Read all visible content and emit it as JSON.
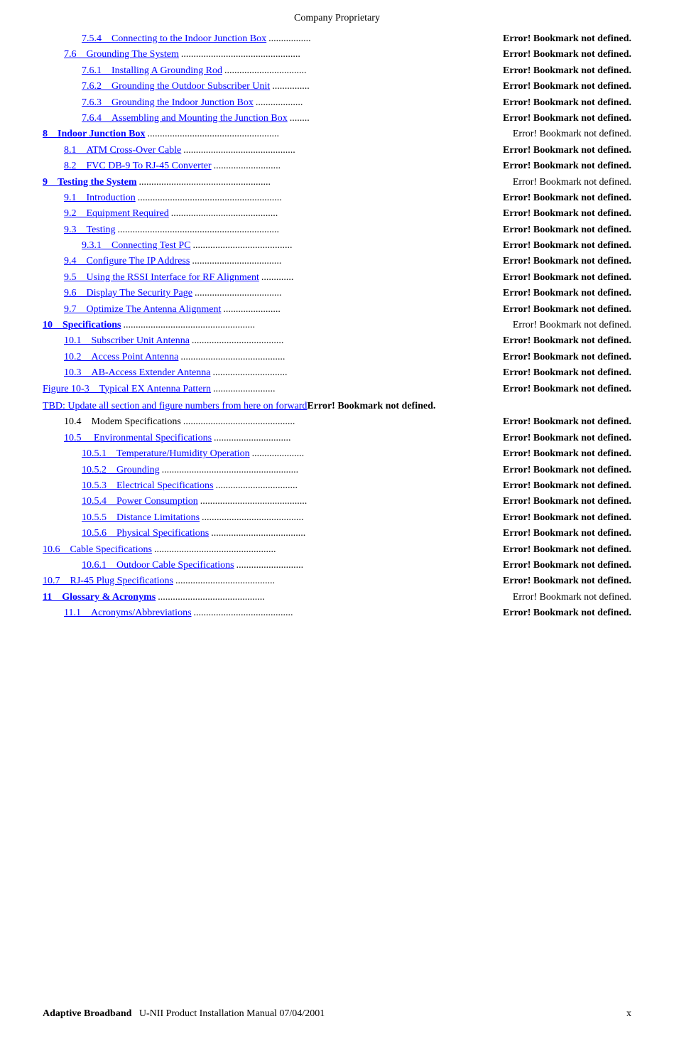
{
  "header": {
    "title": "Company Proprietary"
  },
  "footer": {
    "brand": "Adaptive Broadband",
    "manual": "U-NII Product Installation Manual  07/04/2001",
    "page": "x"
  },
  "toc": {
    "entries": [
      {
        "num": "7.5.4",
        "indent": 2,
        "link": true,
        "title": "Connecting to the Indoor Junction Box",
        "dots": ".................",
        "error": "Error! Bookmark not defined.",
        "error_bold": true
      },
      {
        "num": "7.6",
        "indent": 1,
        "link": true,
        "title": "Grounding The System",
        "dots": "................................................",
        "error": "Error! Bookmark not defined.",
        "error_bold": true
      },
      {
        "num": "7.6.1",
        "indent": 2,
        "link": true,
        "title": "Installing A Grounding Rod",
        "dots": ".................................",
        "error": "Error! Bookmark not defined.",
        "error_bold": true
      },
      {
        "num": "7.6.2",
        "indent": 2,
        "link": true,
        "title": "Grounding the Outdoor Subscriber Unit",
        "dots": "...............",
        "error": "Error! Bookmark not defined.",
        "error_bold": true
      },
      {
        "num": "7.6.3",
        "indent": 2,
        "link": true,
        "title": "Grounding the Indoor Junction Box",
        "dots": "...................",
        "error": "Error! Bookmark not defined.",
        "error_bold": true
      },
      {
        "num": "7.6.4",
        "indent": 2,
        "link": true,
        "title": "Assembling and Mounting the Junction Box",
        "dots": "........",
        "error": "Error! Bookmark not defined.",
        "error_bold": true
      },
      {
        "num": "8",
        "indent": 0,
        "link": true,
        "title": "Indoor Junction Box",
        "bold_title": true,
        "dots": ".....................................................",
        "error": "Error! Bookmark not defined.",
        "error_bold": false
      },
      {
        "num": "8.1",
        "indent": 1,
        "link": true,
        "title": "ATM Cross-Over Cable",
        "dots": ".............................................",
        "error": "Error! Bookmark not defined.",
        "error_bold": true
      },
      {
        "num": "8.2",
        "indent": 1,
        "link": true,
        "title": "FVC DB-9 To RJ-45 Converter",
        "dots": "...........................",
        "error": "Error! Bookmark not defined.",
        "error_bold": true
      },
      {
        "num": "9",
        "indent": 0,
        "link": true,
        "title": "Testing the System",
        "bold_title": true,
        "dots": ".....................................................",
        "error": "Error! Bookmark not defined.",
        "error_bold": false
      },
      {
        "num": "9.1",
        "indent": 1,
        "link": true,
        "title": "Introduction",
        "dots": "..........................................................",
        "error": "Error! Bookmark not defined.",
        "error_bold": true
      },
      {
        "num": "9.2",
        "indent": 1,
        "link": true,
        "title": "Equipment Required",
        "dots": "...........................................",
        "error": "Error! Bookmark not defined.",
        "error_bold": true
      },
      {
        "num": "9.3",
        "indent": 1,
        "link": true,
        "title": "Testing",
        "dots": ".................................................................",
        "error": "Error! Bookmark not defined.",
        "error_bold": true
      },
      {
        "num": "9.3.1",
        "indent": 2,
        "link": true,
        "title": "Connecting Test PC",
        "dots": "........................................",
        "error": "Error! Bookmark not defined.",
        "error_bold": true
      },
      {
        "num": "9.4",
        "indent": 1,
        "link": true,
        "title": "Configure The IP Address",
        "dots": "....................................",
        "error": "Error! Bookmark not defined.",
        "error_bold": true
      },
      {
        "num": "9.5",
        "indent": 1,
        "link": true,
        "title": "Using the RSSI Interface for RF Alignment",
        "dots": ".............",
        "error": "Error! Bookmark not defined.",
        "error_bold": true
      },
      {
        "num": "9.6",
        "indent": 1,
        "link": true,
        "title": "Display The Security Page",
        "dots": "...................................",
        "error": "Error! Bookmark not defined.",
        "error_bold": true
      },
      {
        "num": "9.7",
        "indent": 1,
        "link": true,
        "title": "Optimize The Antenna Alignment",
        "dots": ".......................",
        "error": "Error! Bookmark not defined.",
        "error_bold": true
      },
      {
        "num": "10",
        "indent": 0,
        "link": true,
        "title": "Specifications",
        "bold_title": true,
        "dots": ".....................................................",
        "error": "Error! Bookmark not defined.",
        "error_bold": false
      },
      {
        "num": "10.1",
        "indent": 1,
        "link": true,
        "title": "Subscriber Unit Antenna",
        "dots": ".....................................",
        "error": "Error! Bookmark not defined.",
        "error_bold": true
      },
      {
        "num": "10.2",
        "indent": 1,
        "link": true,
        "title": "Access Point Antenna",
        "dots": "..........................................",
        "error": "Error! Bookmark not defined.",
        "error_bold": true
      },
      {
        "num": "10.3",
        "indent": 1,
        "link": true,
        "title": "AB-Access Extender Antenna",
        "dots": "..............................",
        "error": "Error! Bookmark not defined.",
        "error_bold": true
      },
      {
        "num": "Figure 10-3",
        "indent": 0,
        "link": true,
        "title": "Typical EX Antenna Pattern",
        "dots": ".........................",
        "error": "Error! Bookmark not defined.",
        "error_bold": true
      },
      {
        "num": "",
        "indent": 0,
        "link": true,
        "title": "TBD: Update all section and figure numbers from here on forward",
        "dots": "",
        "error": "Error! Bookmark not defined.",
        "error_bold": true,
        "special": true
      },
      {
        "num": "10.4",
        "indent": 1,
        "link": false,
        "title": "Modem Specifications",
        "dots": ".............................................",
        "error": "Error! Bookmark not defined.",
        "error_bold": true
      },
      {
        "num": "10.5",
        "indent": 1,
        "link": true,
        "title": " Environmental Specifications",
        "dots": "...............................",
        "error": "Error! Bookmark not defined.",
        "error_bold": true
      },
      {
        "num": "10.5.1",
        "indent": 2,
        "link": true,
        "title": "Temperature/Humidity Operation",
        "dots": ".....................",
        "error": "Error! Bookmark not defined.",
        "error_bold": true
      },
      {
        "num": "10.5.2",
        "indent": 2,
        "link": true,
        "title": "Grounding",
        "dots": ".......................................................",
        "error": "Error! Bookmark not defined.",
        "error_bold": true
      },
      {
        "num": "10.5.3",
        "indent": 2,
        "link": true,
        "title": "Electrical Specifications",
        "dots": ".................................",
        "error": "Error! Bookmark not defined.",
        "error_bold": true
      },
      {
        "num": "10.5.4",
        "indent": 2,
        "link": true,
        "title": "Power Consumption",
        "dots": "...........................................",
        "error": "Error! Bookmark not defined.",
        "error_bold": true
      },
      {
        "num": "10.5.5",
        "indent": 2,
        "link": true,
        "title": "Distance Limitations",
        "dots": ".........................................",
        "error": "Error! Bookmark not defined.",
        "error_bold": true
      },
      {
        "num": "10.5.6",
        "indent": 2,
        "link": true,
        "title": "Physical Specifications",
        "dots": "......................................",
        "error": "Error! Bookmark not defined.",
        "error_bold": true
      },
      {
        "num": "10.6",
        "indent": 0,
        "link": true,
        "title": "Cable Specifications",
        "dots": ".................................................",
        "error": "Error! Bookmark not defined.",
        "error_bold": true
      },
      {
        "num": "10.6.1",
        "indent": 2,
        "link": true,
        "title": "Outdoor Cable Specifications",
        "dots": "...........................",
        "error": "Error! Bookmark not defined.",
        "error_bold": true
      },
      {
        "num": "10.7",
        "indent": 0,
        "link": true,
        "title": "RJ-45 Plug Specifications",
        "dots": "........................................",
        "error": "Error! Bookmark not defined.",
        "error_bold": true
      },
      {
        "num": "11",
        "indent": 0,
        "link": true,
        "title": "Glossary & Acronyms",
        "bold_title": true,
        "dots": "...........................................",
        "error": "Error! Bookmark not defined.",
        "error_bold": false
      },
      {
        "num": "11.1",
        "indent": 1,
        "link": true,
        "title": "Acronyms/Abbreviations",
        "dots": "........................................",
        "error": "Error! Bookmark not defined.",
        "error_bold": true
      }
    ]
  }
}
